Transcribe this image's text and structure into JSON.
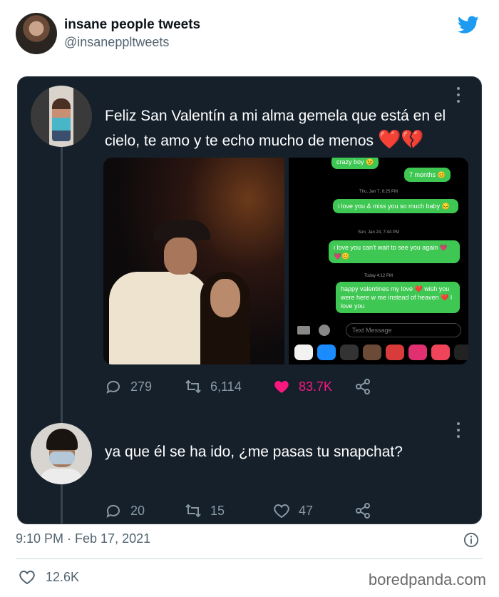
{
  "outer_tweet": {
    "name": "insane people tweets",
    "handle": "@insanepp​ltweets",
    "timestamp": "9:10 PM · Feb 17, 2021",
    "likes": "12.6K"
  },
  "embedded": {
    "tweet1": {
      "text": "Feliz San Valentín a mi alma gemela que está en el cielo, te amo y te echo mucho de menos",
      "emoji": "❤️💔",
      "replies": "279",
      "retweets": "6,114",
      "likes": "83.7K"
    },
    "chat": {
      "bubble_top": "crazy boy 😉",
      "bubble_months": "7 months 😊",
      "ts1": "Thu, Jan 7, 6:25 PM",
      "bubble_miss": "i love you & miss you so much baby 😔",
      "ts2": "Sun, Jan 24, 7:44 PM",
      "bubble_wait": "i love you can't wait to see you again 💗💗😊",
      "ts3": "Today 4:12 PM",
      "bubble_valentines": "happy valentines my love ❤️ wish you were here w me instead of heaven ❤️ I love you",
      "input_placeholder": "Text Message"
    },
    "tweet2": {
      "text": "ya que él se ha ido, ¿me pasas tu snapchat?",
      "replies": "20",
      "retweets": "15",
      "likes": "47"
    }
  },
  "watermark": "boredpanda.com",
  "colors": {
    "dark_bg": "#15202b",
    "like_pink": "#f91880",
    "imessage_green": "#3ec752",
    "twitter_blue": "#1d9bf0"
  }
}
